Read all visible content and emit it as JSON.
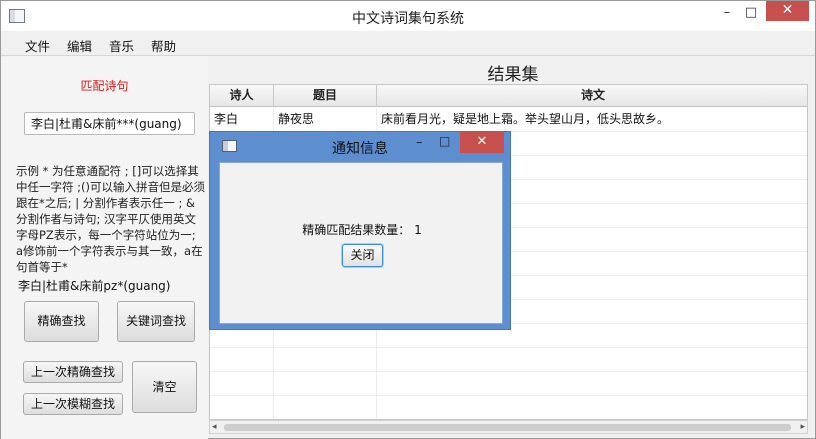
{
  "window": {
    "title": "中文诗词集句系统",
    "min_glyph": "–",
    "max_glyph": "□",
    "close_glyph": "✕"
  },
  "menu": [
    {
      "label": "文件"
    },
    {
      "label": "编辑"
    },
    {
      "label": "音乐"
    },
    {
      "label": "帮助"
    }
  ],
  "left_panel": {
    "section_title": "匹配诗句",
    "query_value": "李白|杜甫&床前***(guang)",
    "help_text": "示例 * 为任意通配符 ; []可以选择其中任一字符 ;()可以输入拼音但是必须跟在*之后; | 分割作者表示任一 ; &分割作者与诗句; 汉字平仄使用英文字母PZ表示，每一个字符站位为一; a修饰前一个字符表示与其一致，a在句首等于*",
    "example_text": "李白|杜甫&床前pz*(guang)",
    "buttons": {
      "exact_search": "精确查找",
      "keyword_search": "关键词查找",
      "prev_exact": "上一次精确查找",
      "prev_fuzzy": "上一次模糊查找",
      "clear": "清空"
    }
  },
  "results": {
    "title": "结果集",
    "columns": [
      "诗人",
      "题目",
      "诗文"
    ],
    "rows": [
      {
        "poet": "李白",
        "title": "静夜思",
        "poem": "床前看月光，疑是地上霜。举头望山月，低头思故乡。"
      },
      {
        "poet": "",
        "title": "",
        "poem": ""
      },
      {
        "poet": "",
        "title": "",
        "poem": ""
      },
      {
        "poet": "",
        "title": "",
        "poem": ""
      },
      {
        "poet": "",
        "title": "",
        "poem": ""
      },
      {
        "poet": "",
        "title": "",
        "poem": ""
      },
      {
        "poet": "",
        "title": "",
        "poem": ""
      },
      {
        "poet": "",
        "title": "",
        "poem": ""
      },
      {
        "poet": "",
        "title": "",
        "poem": ""
      },
      {
        "poet": "",
        "title": "",
        "poem": ""
      },
      {
        "poet": "",
        "title": "",
        "poem": ""
      },
      {
        "poet": "",
        "title": "",
        "poem": ""
      },
      {
        "poet": "",
        "title": "",
        "poem": ""
      }
    ],
    "scroll_left_glyph": "◂",
    "scroll_right_glyph": "▸"
  },
  "dialog": {
    "title": "通知信息",
    "message": "精确匹配结果数量： 1",
    "close_button": "关闭",
    "min_glyph": "–",
    "max_glyph": "□",
    "close_glyph": "✕"
  },
  "colors": {
    "accent_red": "#e01818",
    "dialog_frame": "#5d8fd0",
    "close_red": "#c7504f"
  }
}
